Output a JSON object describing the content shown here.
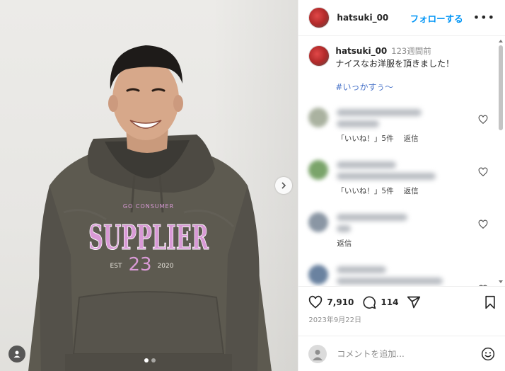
{
  "post": {
    "username": "hatsuki_00",
    "follow_label": "フォローする",
    "more_label": "•••",
    "caption": {
      "username": "hatsuki_00",
      "time": "123週間前",
      "text": "ナイスなお洋服を頂きました！",
      "hashtag": "#いっかすぅ〜"
    },
    "hoodie_print": {
      "top": "GO CONSUMER",
      "main": "SUPPLIER",
      "left": "EST",
      "number": "23",
      "right": "2020"
    }
  },
  "comments": [
    {
      "likes_text": "「いいね！」5件",
      "reply_label": "返信"
    },
    {
      "likes_text": "「いいね！」5件",
      "reply_label": "返信"
    },
    {
      "likes_text": "",
      "reply_label": "返信"
    },
    {
      "likes_text": "",
      "reply_label": ""
    }
  ],
  "actions": {
    "likes": "7,910",
    "comments": "114",
    "date": "2023年9月22日"
  },
  "add_comment": {
    "placeholder": "コメントを追加..."
  },
  "colors": {
    "accent": "#0095f6",
    "hashtag": "#4a74c9",
    "hoodie": "#5d5a50",
    "print": "#d99ad6"
  },
  "icons": [
    "heart-icon",
    "comment-icon",
    "share-icon",
    "bookmark-icon",
    "emoji-icon",
    "more-icon",
    "chevron-right-icon",
    "user-tag-icon"
  ]
}
